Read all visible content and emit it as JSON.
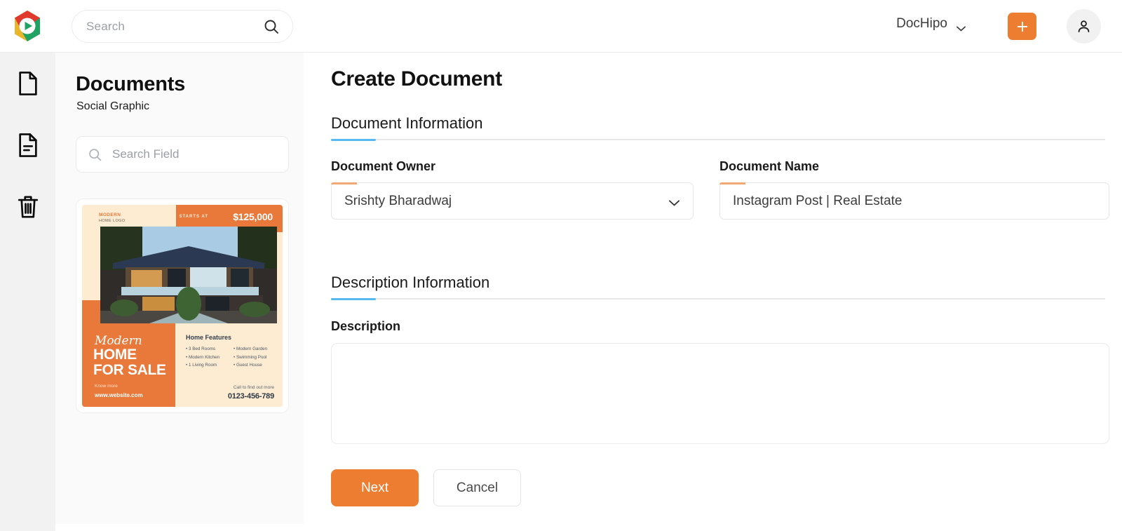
{
  "header": {
    "logo_icon": "dochipo-hexagon-logo",
    "search": {
      "placeholder": "Search",
      "value": "",
      "icon": "search-icon"
    },
    "workspace": {
      "label": "DocHipo",
      "icon": "chevron-down-icon"
    },
    "create_button": {
      "label": "+",
      "icon": "plus-icon",
      "color": "#ed7d31"
    },
    "account_button": {
      "icon": "user-avatar-icon"
    }
  },
  "rail": {
    "items": [
      {
        "name": "documents",
        "icon": "document-blank-icon"
      },
      {
        "name": "templates",
        "icon": "document-lines-icon"
      },
      {
        "name": "trash",
        "icon": "trash-icon"
      }
    ]
  },
  "documents_panel": {
    "title": "Documents",
    "subtitle": "Social Graphic",
    "search": {
      "placeholder": "Search Field",
      "value": "",
      "icon": "search-icon"
    },
    "thumbnail": {
      "logo_line1": "MODERN",
      "logo_line2": "HOME LOGO",
      "starts_at": "STARTS AT",
      "price": "$125,000",
      "script_word": "Modern",
      "headline_line1": "HOME",
      "headline_line2": "FOR SALE",
      "know_more": "Know more",
      "website": "www.website.com",
      "features_title": "Home Features",
      "features": [
        "3 Bed Rooms",
        "Modern Garden",
        "Modern Kitchen",
        "Swimming Pool",
        "1 Living Room",
        "Guest House"
      ],
      "call_text": "Call to find out more",
      "phone": "0123-456-789"
    }
  },
  "main": {
    "page_title": "Create Document",
    "sections": {
      "document_information": {
        "heading": "Document Information",
        "owner": {
          "label": "Document Owner",
          "value": "Srishty Bharadwaj",
          "icon": "chevron-down-icon"
        },
        "name": {
          "label": "Document Name",
          "value": "Instagram Post | Real Estate"
        }
      },
      "description_information": {
        "heading": "Description Information",
        "description": {
          "label": "Description",
          "value": "",
          "placeholder": ""
        }
      }
    },
    "buttons": {
      "next": "Next",
      "cancel": "Cancel"
    }
  },
  "colors": {
    "accent_orange": "#ed7d31",
    "accent_blue": "#56b9f0",
    "field_accent": "#f0a875",
    "rail_bg": "#f2f2f2",
    "panel_bg": "#fafafa"
  }
}
